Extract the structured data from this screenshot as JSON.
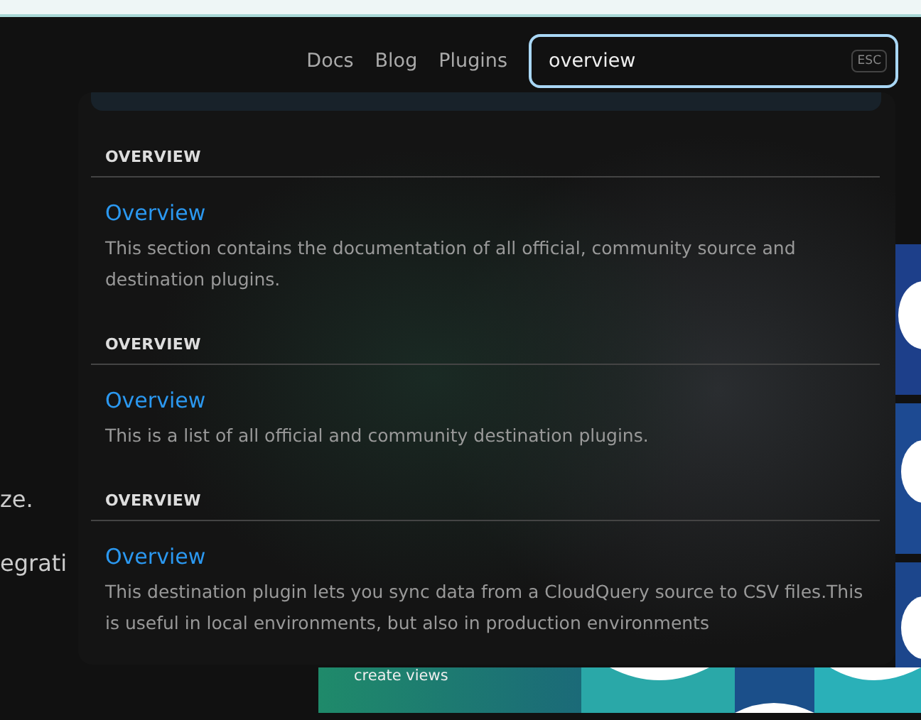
{
  "nav": {
    "links": [
      {
        "label": "Docs"
      },
      {
        "label": "Blog"
      },
      {
        "label": "Plugins"
      }
    ],
    "search": {
      "value": "overview",
      "shortcut": "ESC"
    }
  },
  "page": {
    "texts": [
      "ze.",
      "egrati"
    ],
    "banner_caption": "create views"
  },
  "results": [
    {
      "section": "OVERVIEW",
      "title": "Overview",
      "description": "This section contains the documentation of all official, community source and destination plugins."
    },
    {
      "section": "OVERVIEW",
      "title": "Overview",
      "description": "This is a list of all official and community destination plugins."
    },
    {
      "section": "OVERVIEW",
      "title": "Overview",
      "description": "This destination plugin lets you sync data from a CloudQuery source to CSV files.This is useful in local environments, but also in production environments"
    }
  ]
}
